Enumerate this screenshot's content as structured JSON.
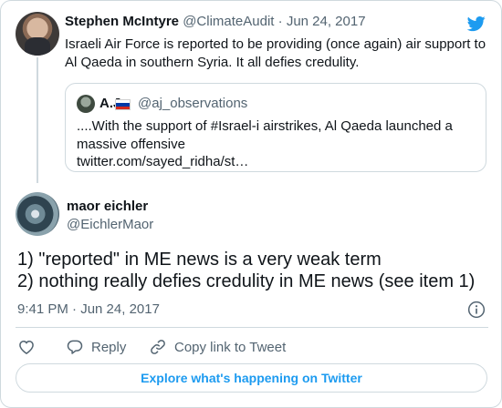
{
  "parent_tweet": {
    "author_name": "Stephen McIntyre",
    "handle": "@ClimateAudit",
    "separator": "·",
    "date": "Jun 24, 2017",
    "text": "Israeli Air Force is reported to be providing (once again) air support to Al Qaeda in southern Syria. It all defies credulity.",
    "quote": {
      "author_name": "A.J",
      "handle": "@aj_observations",
      "text": "....With the support of #Israel-i airstrikes, Al Qaeda launched a massive offensive",
      "link": "twitter.com/sayed_ridha/st…"
    }
  },
  "reply": {
    "author_name": "maor eichler",
    "handle": "@EichlerMaor",
    "text_line1": "1) \"reported\" in ME news is a very weak term",
    "text_line2": "2) nothing really defies credulity in ME news (see item 1)",
    "timestamp": "9:41 PM · Jun 24, 2017"
  },
  "actions": {
    "like_icon": "heart-icon",
    "reply_label": "Reply",
    "copy_label": "Copy link to Tweet"
  },
  "explore_label": "Explore what's happening on Twitter",
  "colors": {
    "accent": "#1d9bf0",
    "text": "#0f1419",
    "secondary": "#536471",
    "border": "#cfd9de"
  }
}
